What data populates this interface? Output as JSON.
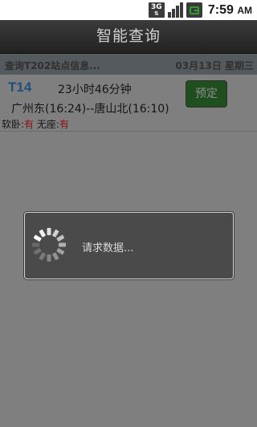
{
  "status_bar": {
    "network": "3G",
    "time": "7:59",
    "ampm": "AM",
    "icons": [
      "3g-signal-icon",
      "signal-bars-icon",
      "battery-icon"
    ]
  },
  "header": {
    "title": "智能查询"
  },
  "info_bar": {
    "query_text": "查询T202站点信息...",
    "date_text": "03月13日 星期三"
  },
  "train": {
    "number": "T14",
    "duration": "23小时46分钟",
    "route": "广州东(16:24)--唐山北(16:10)",
    "soft_sleeper_label": "软卧:",
    "soft_sleeper_value": "有",
    "no_seat_label": "无座:",
    "no_seat_value": "有",
    "book_label": "预定"
  },
  "dialog": {
    "message": "请求数据..."
  },
  "colors": {
    "train_number": "#1f4f7a",
    "availability": "#8a1212",
    "book_button": "#1f4f1f"
  }
}
